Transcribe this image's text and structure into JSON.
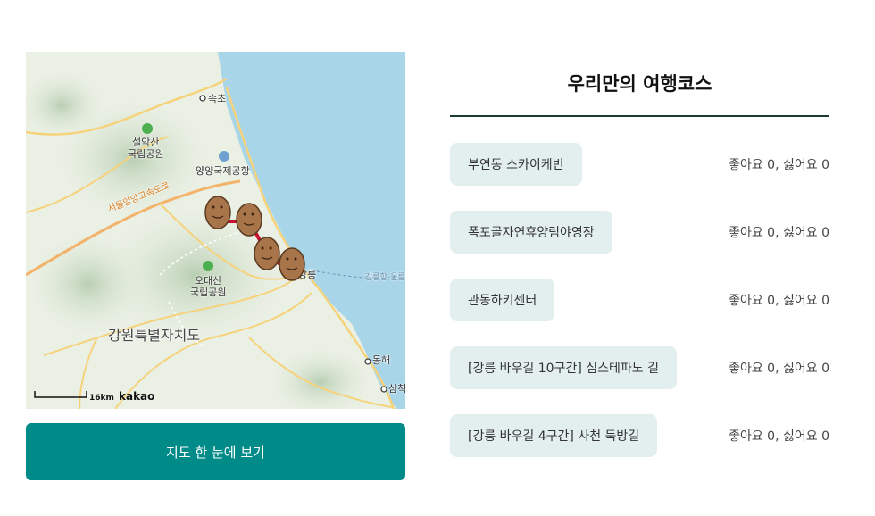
{
  "map": {
    "labels": {
      "sokcho": "속초",
      "seorak": "설악산\n국립공원",
      "airport": "양양국제공항",
      "expressway": "서울양양고속도로",
      "odae": "오대산\n국립공원",
      "province": "강원특별자치도",
      "gangneung": "강릉",
      "donghae": "동해",
      "samcheok": "삼척",
      "port": "강릉항-울릉"
    },
    "scale_label": "16km",
    "brand": "kakao",
    "marker_icon": "potato-marker-icon"
  },
  "map_button_label": "지도 한 눈에 보기",
  "course": {
    "title": "우리만의 여행코스",
    "items": [
      {
        "name": "부연동 스카이케빈",
        "votes": "좋아요 0, 싫어요 0"
      },
      {
        "name": "폭포골자연휴양림야영장",
        "votes": "좋아요 0, 싫어요 0"
      },
      {
        "name": "관동하키센터",
        "votes": "좋아요 0, 싫어요 0"
      },
      {
        "name": "[강릉 바우길 10구간] 심스테파노 길",
        "votes": "좋아요 0, 싫어요 0"
      },
      {
        "name": "[강릉 바우길 4구간] 사천 둑방길",
        "votes": "좋아요 0, 싫어요 0"
      }
    ]
  },
  "colors": {
    "accent": "#008b88",
    "chip_bg": "#e3efef",
    "divider": "#1e3d32",
    "route": "#c4122f",
    "sea": "#a9d5e9"
  }
}
